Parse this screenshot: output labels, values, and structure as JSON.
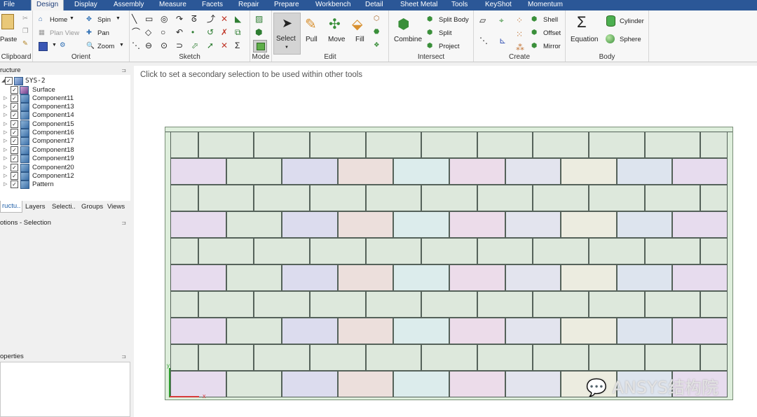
{
  "menu": {
    "tabs": [
      "File",
      "Design",
      "Display",
      "Assembly",
      "Measure",
      "Facets",
      "Repair",
      "Prepare",
      "Workbench",
      "Detail",
      "Sheet Metal",
      "Tools",
      "KeyShot",
      "Momentum"
    ],
    "active": "Design"
  },
  "ribbon": {
    "clipboard": {
      "title": "Clipboard",
      "paste": "Paste"
    },
    "orient": {
      "title": "Orient",
      "home": "Home",
      "plan_view": "Plan View",
      "spin": "Spin",
      "pan": "Pan",
      "zoom": "Zoom"
    },
    "sketch": {
      "title": "Sketch"
    },
    "mode": {
      "title": "Mode"
    },
    "edit": {
      "title": "Edit",
      "select": "Select",
      "pull": "Pull",
      "move": "Move",
      "fill": "Fill"
    },
    "intersect": {
      "title": "Intersect",
      "combine": "Combine",
      "split_body": "Split Body",
      "split": "Split",
      "project": "Project"
    },
    "create": {
      "title": "Create",
      "shell": "Shell",
      "offset": "Offset",
      "mirror": "Mirror"
    },
    "body": {
      "title": "Body",
      "equation": "Equation",
      "cylinder": "Cylinder",
      "sphere": "Sphere"
    }
  },
  "structure": {
    "title": "ructure",
    "items": [
      "SYS-2",
      "Surface",
      "Component11",
      "Component13",
      "Component14",
      "Component15",
      "Component16",
      "Component17",
      "Component18",
      "Component19",
      "Component20",
      "Component12",
      "Pattern"
    ],
    "tabs": [
      "ructu..",
      "Layers",
      "Selecti..",
      "Groups",
      "Views"
    ]
  },
  "options_panel": {
    "title": "otions - Selection"
  },
  "properties_panel": {
    "title": "operties"
  },
  "viewport": {
    "hint": "Click to set a secondary selection to be used within other tools",
    "axis_x": "x",
    "axis_y": "y",
    "watermark": "ANSYS结构院"
  },
  "colors": {
    "menubar": "#2b5797",
    "wall_base": "#deeedc",
    "brick_colors": [
      "#e7dcee",
      "#dde8dc",
      "#dcdcee",
      "#ecdfdc",
      "#dcecec",
      "#ecdcea",
      "#e3e4ee",
      "#ecece0",
      "#dde4ee"
    ]
  }
}
